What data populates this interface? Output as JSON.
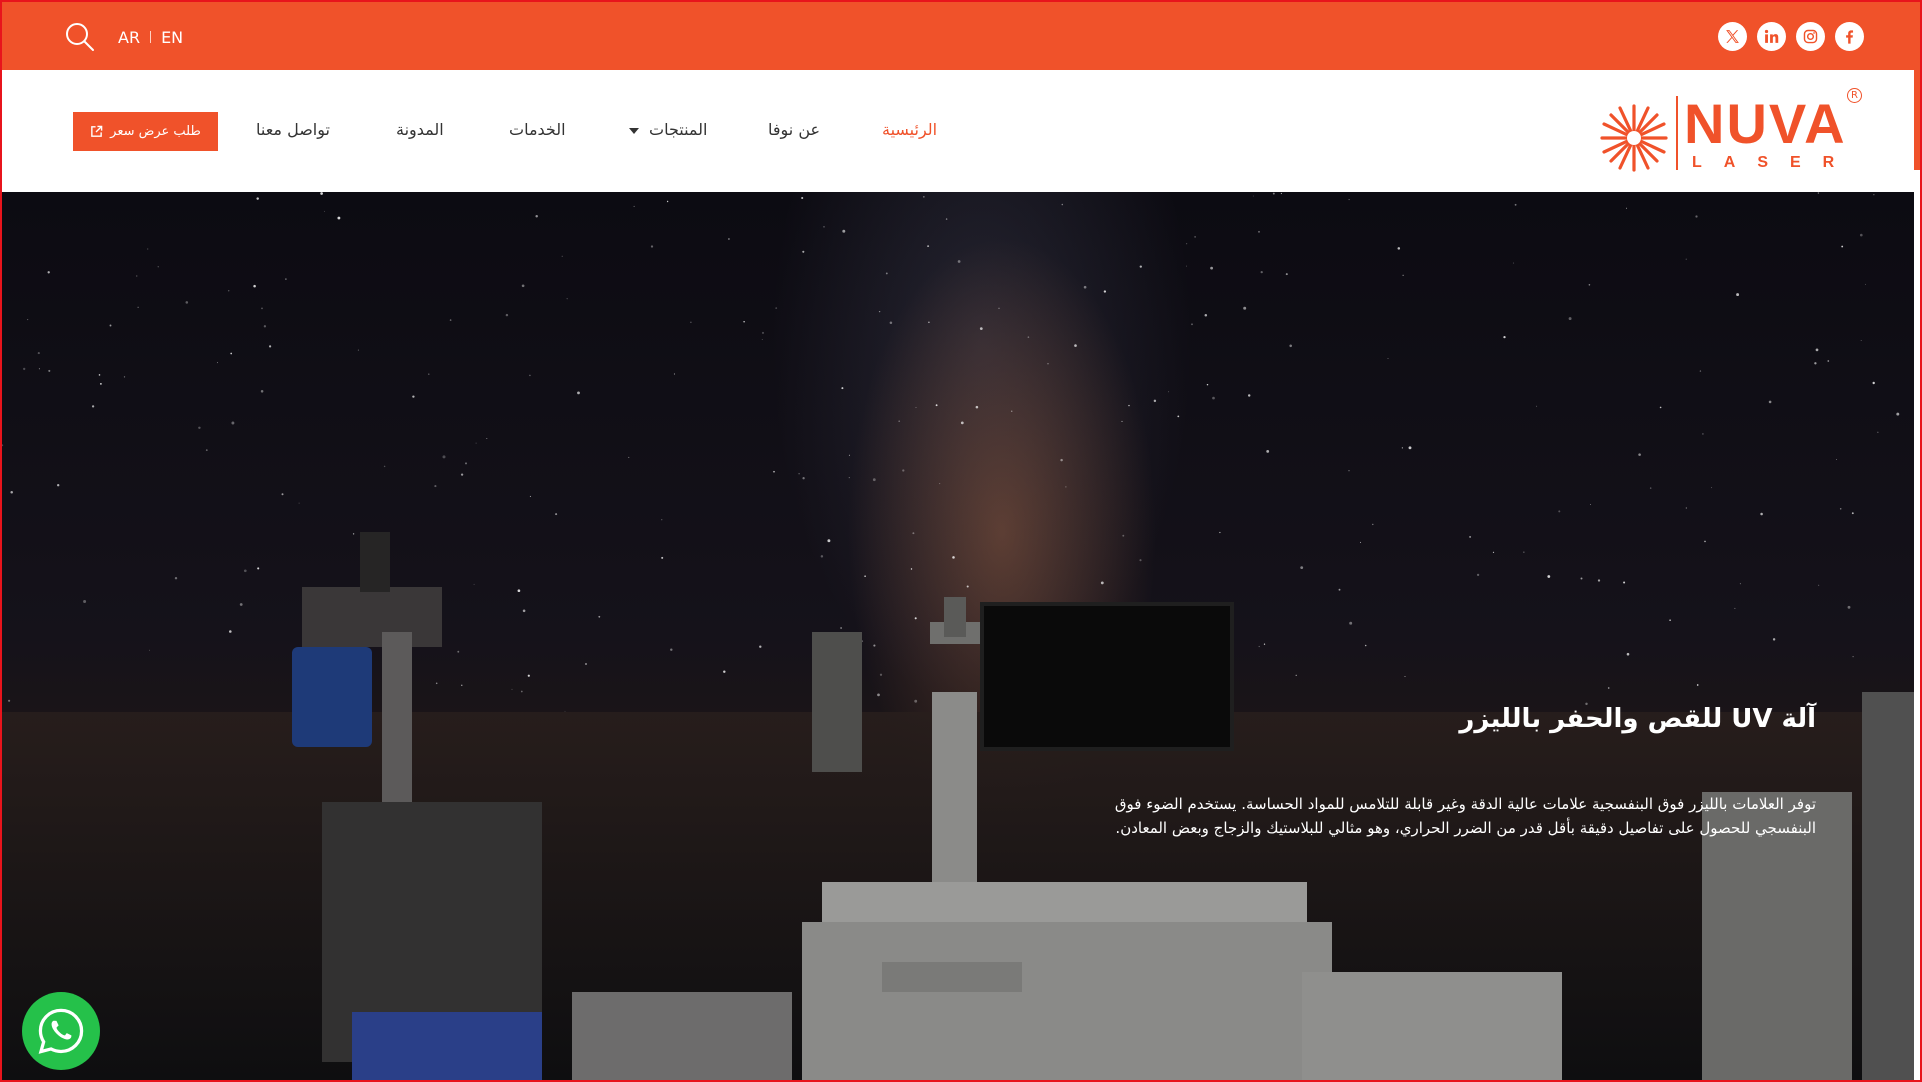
{
  "topbar": {
    "lang_ar": "AR",
    "lang_en": "EN",
    "socials": [
      "x-icon",
      "linkedin-icon",
      "instagram-icon",
      "facebook-icon"
    ]
  },
  "brand": {
    "name": "NUVA",
    "sub": "LASER",
    "reg": "R"
  },
  "nav": {
    "home": "الرئيسية",
    "about": "عن نوفا",
    "products": "المنتجات",
    "services": "الخدمات",
    "blog": "المدونة",
    "contact": "تواصل معنا",
    "quote": "طلب عرض سعر"
  },
  "hero": {
    "title": "آلة UV للقص والحفر بالليزر",
    "text": "توفر العلامات بالليزر فوق البنفسجية علامات عالية الدقة وغير قابلة للتلامس للمواد الحساسة. يستخدم الضوء فوق البنفسجي للحصول على تفاصيل دقيقة بأقل قدر من الضرر الحراري، وهو مثالي للبلاستيك والزجاج وبعض المعادن."
  },
  "colors": {
    "accent": "#f0522a",
    "whatsapp": "#25c14a",
    "frame": "#e8141c"
  }
}
